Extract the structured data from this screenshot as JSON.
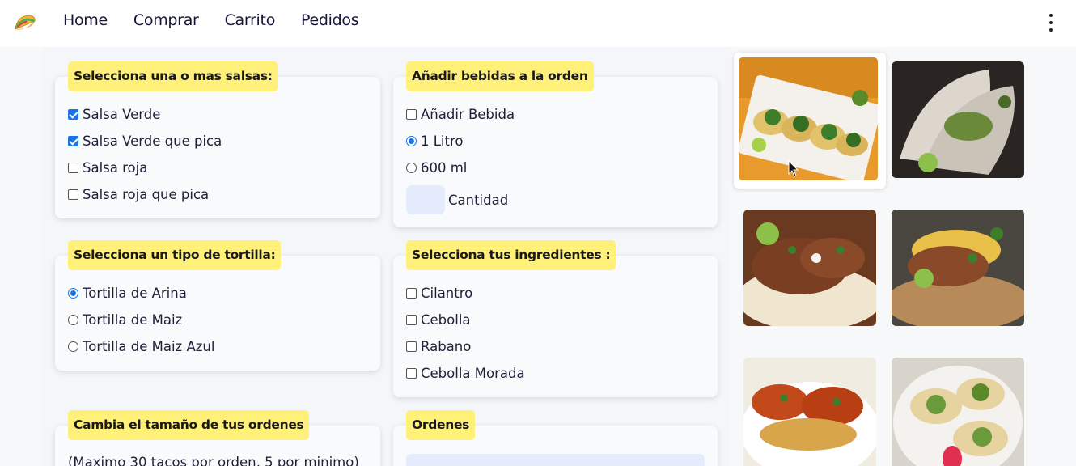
{
  "nav": {
    "logo_icon": "taco-icon",
    "links": [
      "Home",
      "Comprar",
      "Carrito",
      "Pedidos"
    ],
    "menu_icon": "kebab-menu-icon"
  },
  "salsas": {
    "legend": "Selecciona una o mas salsas:",
    "options": [
      {
        "label": "Salsa Verde",
        "checked": true
      },
      {
        "label": "Salsa Verde que pica",
        "checked": true
      },
      {
        "label": "Salsa roja",
        "checked": false
      },
      {
        "label": "Salsa roja que pica",
        "checked": false
      }
    ]
  },
  "bebidas": {
    "legend": "Añadir bebidas a la orden",
    "add_label": "Añadir Bebida",
    "add_checked": false,
    "sizes": [
      {
        "label": "1 Litro",
        "selected": true
      },
      {
        "label": "600 ml",
        "selected": false
      }
    ],
    "quantity_label": "Cantidad",
    "quantity_value": ""
  },
  "tortilla": {
    "legend": "Selecciona un tipo de tortilla:",
    "options": [
      {
        "label": "Tortilla de Arina",
        "selected": true
      },
      {
        "label": "Tortilla de Maiz",
        "selected": false
      },
      {
        "label": "Tortilla de Maiz Azul",
        "selected": false
      }
    ]
  },
  "ingredientes": {
    "legend": "Selecciona tus ingredientes :",
    "options": [
      {
        "label": "Cilantro",
        "checked": false
      },
      {
        "label": "Cebolla",
        "checked": false
      },
      {
        "label": "Rabano",
        "checked": false
      },
      {
        "label": "Cebolla Morada",
        "checked": false
      }
    ]
  },
  "tamano": {
    "legend": "Cambia el tamaño de tus ordenes",
    "note": "(Maximo 30 tacos por orden, 5 por minimo)"
  },
  "ordenes": {
    "legend": "Ordenes"
  },
  "colors": {
    "legend_bg": "#fff07a",
    "accent": "#1a73e8",
    "input_bg": "#e3ebfd"
  }
}
